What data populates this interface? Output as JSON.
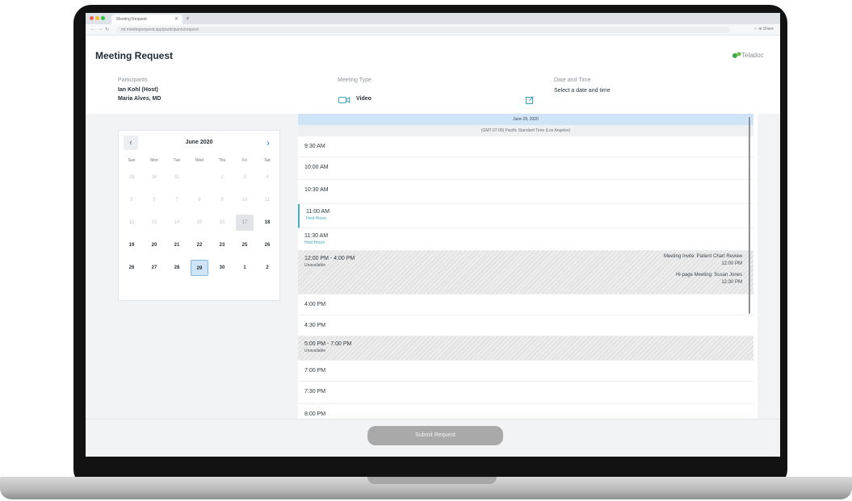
{
  "browser": {
    "tab_title": "Meeting Request",
    "url": "ml.meetingrequest.app/participants/request",
    "right_text": "☆ ⊕ Share"
  },
  "app": {
    "title": "Meeting Request",
    "logo_text": "Teladoc"
  },
  "participants": {
    "label": "Participants",
    "host": "Ian Kohl (Host)",
    "other": "Maria Alves, MD"
  },
  "meeting_type": {
    "label": "Meeting Type",
    "value": "Video"
  },
  "date_time": {
    "label": "Date and Time",
    "value": "Select a date and time"
  },
  "calendar": {
    "month": "June 2020",
    "prev": "‹",
    "next": "›",
    "weekdays": [
      "Sun",
      "Mon",
      "Tue",
      "Wed",
      "Thu",
      "Fri",
      "Sat"
    ],
    "weeks": [
      [
        "29",
        "30",
        "31",
        "",
        "2",
        "3",
        "4"
      ],
      [
        "5",
        "5",
        "7",
        "8",
        "9",
        "10",
        "11"
      ],
      [
        "12",
        "13",
        "14",
        "15",
        "15",
        "17",
        "18"
      ],
      [
        "19",
        "20",
        "21",
        "22",
        "23",
        "25",
        "26"
      ],
      [
        "26",
        "27",
        "28",
        "29",
        "30",
        "1",
        "2"
      ]
    ],
    "selected": "29",
    "today": "17"
  },
  "schedule": {
    "date_header": "June 29, 2020",
    "timezone": "(GMT-07:00) Pacific Standard Time (Los Angeles)",
    "slots": [
      {
        "time": "9:30 AM",
        "sub": "",
        "style": "normal"
      },
      {
        "time": "10:00 AM",
        "sub": "",
        "style": "normal"
      },
      {
        "time": "10:30 AM",
        "sub": "",
        "style": "normal"
      },
      {
        "time": "11:00 AM",
        "sub": "Host Hours",
        "style": "selected"
      },
      {
        "time": "11:30 AM",
        "sub": "Host Hours",
        "style": "normal"
      },
      {
        "time": "12:00 PM - 4:00 PM",
        "sub": "Unavailable",
        "style": "hatched"
      },
      {
        "time": "4:00 PM",
        "sub": "",
        "style": "normal"
      },
      {
        "time": "4:30 PM",
        "sub": "",
        "style": "normal"
      },
      {
        "time": "5:00 PM - 7:00 PM",
        "sub": "Unavailable",
        "style": "hatched"
      },
      {
        "time": "7:00 PM",
        "sub": "",
        "style": "normal"
      },
      {
        "time": "7:30 PM",
        "sub": "",
        "style": "normal"
      },
      {
        "time": "8:00 PM",
        "sub": "",
        "style": "normal"
      }
    ],
    "events": [
      {
        "title": "Meeting Invite: Patient Chart Review",
        "time": "12:00 PM"
      },
      {
        "title": "Hi-page Meeting: Susan Jones",
        "time": "12:30 PM"
      }
    ]
  },
  "footer": {
    "submit_label": "Submit Request"
  },
  "colors": {
    "accent_blue": "#2b7fd1",
    "teal": "#38b3c9",
    "date_header_bg": "#cfe4f6",
    "submit_disabled": "#a9a9a9"
  },
  "icons": [
    "video-icon",
    "edit-icon",
    "chevron-left-icon",
    "chevron-right-icon",
    "logo-icon"
  ]
}
